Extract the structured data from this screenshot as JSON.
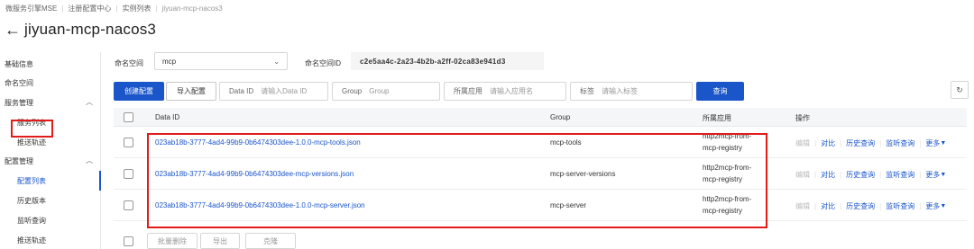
{
  "breadcrumb": [
    "微服务引擎MSE",
    "注册配置中心",
    "实例列表",
    "jiyuan-mcp-nacos3"
  ],
  "page_title": "jiyuan-mcp-nacos3",
  "back_icon": "arrow-left-icon",
  "sidebar": {
    "items": [
      {
        "label": "基础信息"
      },
      {
        "label": "命名空间"
      },
      {
        "label": "服务管理",
        "expanded": true,
        "children": [
          "服务列表",
          "推送轨迹"
        ]
      },
      {
        "label": "配置管理",
        "expanded": true,
        "children": [
          "配置列表",
          "历史版本",
          "监听查询",
          "推送轨迹"
        ]
      }
    ],
    "active": "配置列表"
  },
  "namespace": {
    "label": "命名空间",
    "value": "mcp",
    "id_label": "命名空间ID",
    "id_value": "c2e5aa4c-2a23-4b2b-a2ff-02ca83e941d3"
  },
  "toolbar": {
    "create": "创建配置",
    "import": "导入配置",
    "data_id_label": "Data ID",
    "data_id_placeholder": "请输入Data ID",
    "group_label": "Group",
    "group_placeholder": "Group",
    "app_label": "所属应用",
    "app_placeholder": "请输入应用名",
    "tag_label": "标签",
    "tag_placeholder": "请输入标签",
    "search": "查询"
  },
  "table": {
    "headers": [
      "Data ID",
      "Group",
      "所属应用",
      "操作"
    ],
    "rows": [
      {
        "data_id": "023ab18b-3777-4ad4-99b9-0b6474303dee-1.0.0-mcp-tools.json",
        "group": "mcp-tools",
        "app1": "http2mcp-from-",
        "app2": "mcp-registry"
      },
      {
        "data_id": "023ab18b-3777-4ad4-99b9-0b6474303dee-mcp-versions.json",
        "group": "mcp-server-versions",
        "app1": "http2mcp-from-",
        "app2": "mcp-registry"
      },
      {
        "data_id": "023ab18b-3777-4ad4-99b9-0b6474303dee-1.0.0-mcp-server.json",
        "group": "mcp-server",
        "app1": "http2mcp-from-",
        "app2": "mcp-registry"
      }
    ],
    "ops": {
      "edit": "编辑",
      "compare": "对比",
      "history": "历史查询",
      "listen": "监听查询",
      "more": "更多"
    }
  },
  "footer": {
    "batch_delete": "批量删除",
    "export": "导出",
    "clone": "克隆"
  },
  "colors": {
    "primary": "#1a55c9",
    "highlight": "#e21a1a"
  }
}
